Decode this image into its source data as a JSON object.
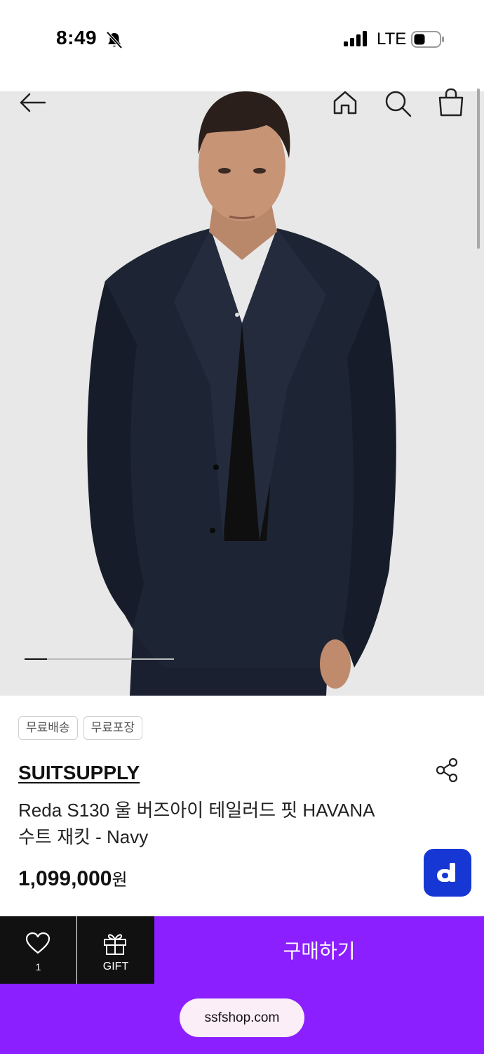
{
  "status_bar": {
    "time": "8:49",
    "network": "LTE",
    "icons": [
      "bell-slash-icon",
      "signal-icon",
      "battery-icon"
    ]
  },
  "nav": {
    "icons": [
      "back-arrow-icon",
      "home-icon",
      "search-icon",
      "shopping-bag-icon"
    ]
  },
  "gallery": {
    "slide_progress": 0.15
  },
  "badges": [
    "무료배송",
    "무료포장"
  ],
  "product": {
    "brand": "SUITSUPPLY",
    "name_line1": "Reda S130 울 버즈아이 테일러드 핏 HAVANA",
    "name_line2": "수트 재킷 - Navy",
    "price": "1,099,000",
    "price_unit": "원"
  },
  "floating_button": {
    "label": "d"
  },
  "bottom_bar": {
    "like_count": "1",
    "gift_label": "GIFT",
    "buy_label": "구매하기"
  },
  "browser": {
    "url": "ssfshop.com"
  },
  "colors": {
    "accent": "#8b1fff",
    "dark": "#111111",
    "floating_button": "#1737d4",
    "image_background": "#e8e8e8"
  }
}
